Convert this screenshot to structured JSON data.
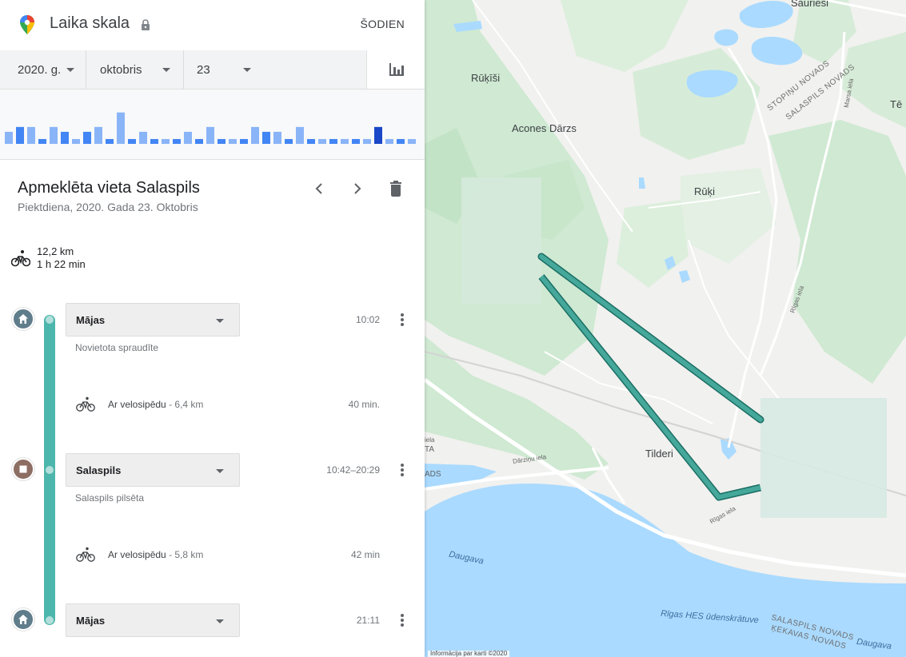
{
  "header": {
    "title": "Laika skala",
    "today_label": "ŠODIEN"
  },
  "date_selector": {
    "year": "2020. g.",
    "month": "oktobris",
    "day": "23"
  },
  "histogram": {
    "values": [
      2,
      3,
      3,
      1,
      3,
      2,
      1,
      2,
      3,
      1,
      6,
      1,
      2,
      1,
      1,
      1,
      2,
      1,
      3,
      1,
      1,
      1,
      3,
      2,
      2,
      1,
      3,
      1,
      1,
      1,
      1,
      1,
      1,
      3,
      1,
      1,
      1
    ],
    "highlight_index": 33,
    "bar_color": "#4285f4",
    "light_bar_color": "#8ab4f8",
    "highlight_color": "#1a47c8"
  },
  "visit": {
    "title": "Apmeklēta vieta Salaspils",
    "subtitle": "Piektdiena, 2020. Gada 23. Oktobris"
  },
  "summary": {
    "distance": "12,2 km",
    "duration": "1 h 22 min"
  },
  "timeline": {
    "line_color": "#4db6ac",
    "places": [
      {
        "name": "Mājas",
        "subtitle": "Novietota spraudīte",
        "time": "10:02",
        "marker": "home-icon",
        "marker_color": "#607d8b"
      },
      {
        "name": "Salaspils",
        "subtitle": "Salaspils pilsēta",
        "time": "10:42–20:29",
        "marker": "stop-icon",
        "marker_color": "#8d6e63"
      },
      {
        "name": "Mājas",
        "subtitle": "",
        "time": "21:11",
        "marker": "home-icon",
        "marker_color": "#607d8b"
      }
    ],
    "activities": [
      {
        "label": "Ar velosipēdu",
        "distance": "- 6,4 km",
        "duration": "40 min."
      },
      {
        "label": "Ar velosipēdu",
        "distance": "- 5,8 km",
        "duration": "42 min"
      }
    ]
  },
  "map": {
    "labels": {
      "sauriesi": "Sauriesi",
      "rukisi": "Rūķīši",
      "acones": "Acones Dārzs",
      "ruki": "Rūķi",
      "tilderi": "Tilderi",
      "te": "Tē",
      "daugava1": "Daugava",
      "daugava2": "Daugava",
      "hes": "Rīgas HES ūdenskrātuve",
      "stopinu": "STOPIŅU NOVADS",
      "salaspils_nov": "SALASPILS NOVADS",
      "salaspils_nov2": "SALASPILS NOVADS",
      "kekavas": "ĶEKAVAS NOVADS",
      "darzinu": "Dārziņu iela",
      "rigas1": "Rīgas iela",
      "rigas2": "Rīgas iela",
      "marsa": "Marsa iela",
      "ads": "ADS",
      "ta": "TA",
      "iela": "iela"
    },
    "route_color": "#45a89a",
    "water_color": "#aadaff",
    "forest_color": "#cfe9d2",
    "attribution": "Informācija par karti ©2020"
  }
}
